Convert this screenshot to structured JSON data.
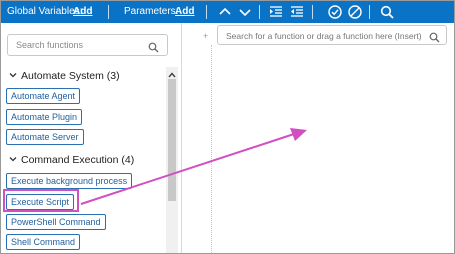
{
  "toolbar": {
    "global_variables_label": "Global Variables:",
    "global_variables_add": "Add",
    "parameters_label": "Parameters:",
    "parameters_add": "Add",
    "icons": [
      "chevron-up-icon",
      "chevron-down-icon",
      "indent-icon",
      "outdent-icon",
      "enable-icon",
      "disable-icon",
      "search-icon"
    ]
  },
  "sidebar": {
    "search_placeholder": "Search functions",
    "groups": [
      {
        "title": "Automate System (3)",
        "expanded": true,
        "items": [
          "Automate Agent",
          "Automate Plugin",
          "Automate Server"
        ]
      },
      {
        "title": "Command Execution (4)",
        "expanded": true,
        "items": [
          "Execute background process",
          "Execute Script",
          "PowerShell Command",
          "Shell Command"
        ]
      }
    ]
  },
  "main": {
    "search_placeholder": "Search for a function or drag a function here (Insert)"
  },
  "annotation": {
    "highlighted_item": "Execute Script",
    "color": "#d24fc1"
  },
  "colors": {
    "toolbar_bg": "#0a73c6",
    "item_border": "#2a6fb0",
    "highlight": "#d24fc1"
  }
}
